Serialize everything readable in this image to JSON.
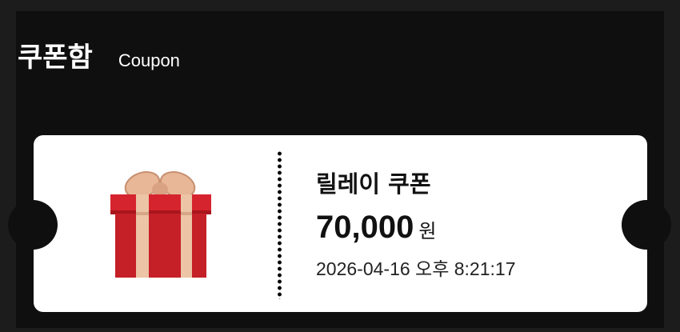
{
  "header": {
    "title": "쿠폰함",
    "subtitle": "Coupon"
  },
  "coupon": {
    "name": "릴레이 쿠폰",
    "amount": "70,000",
    "unit": "원",
    "issued_at": "2026-04-16 오후 8:21:17",
    "image_icon": "gift-box-icon"
  },
  "colors": {
    "background": "#0f0f0f",
    "card": "#ffffff",
    "gift_red": "#c8202a",
    "ribbon": "#e9b89a"
  }
}
